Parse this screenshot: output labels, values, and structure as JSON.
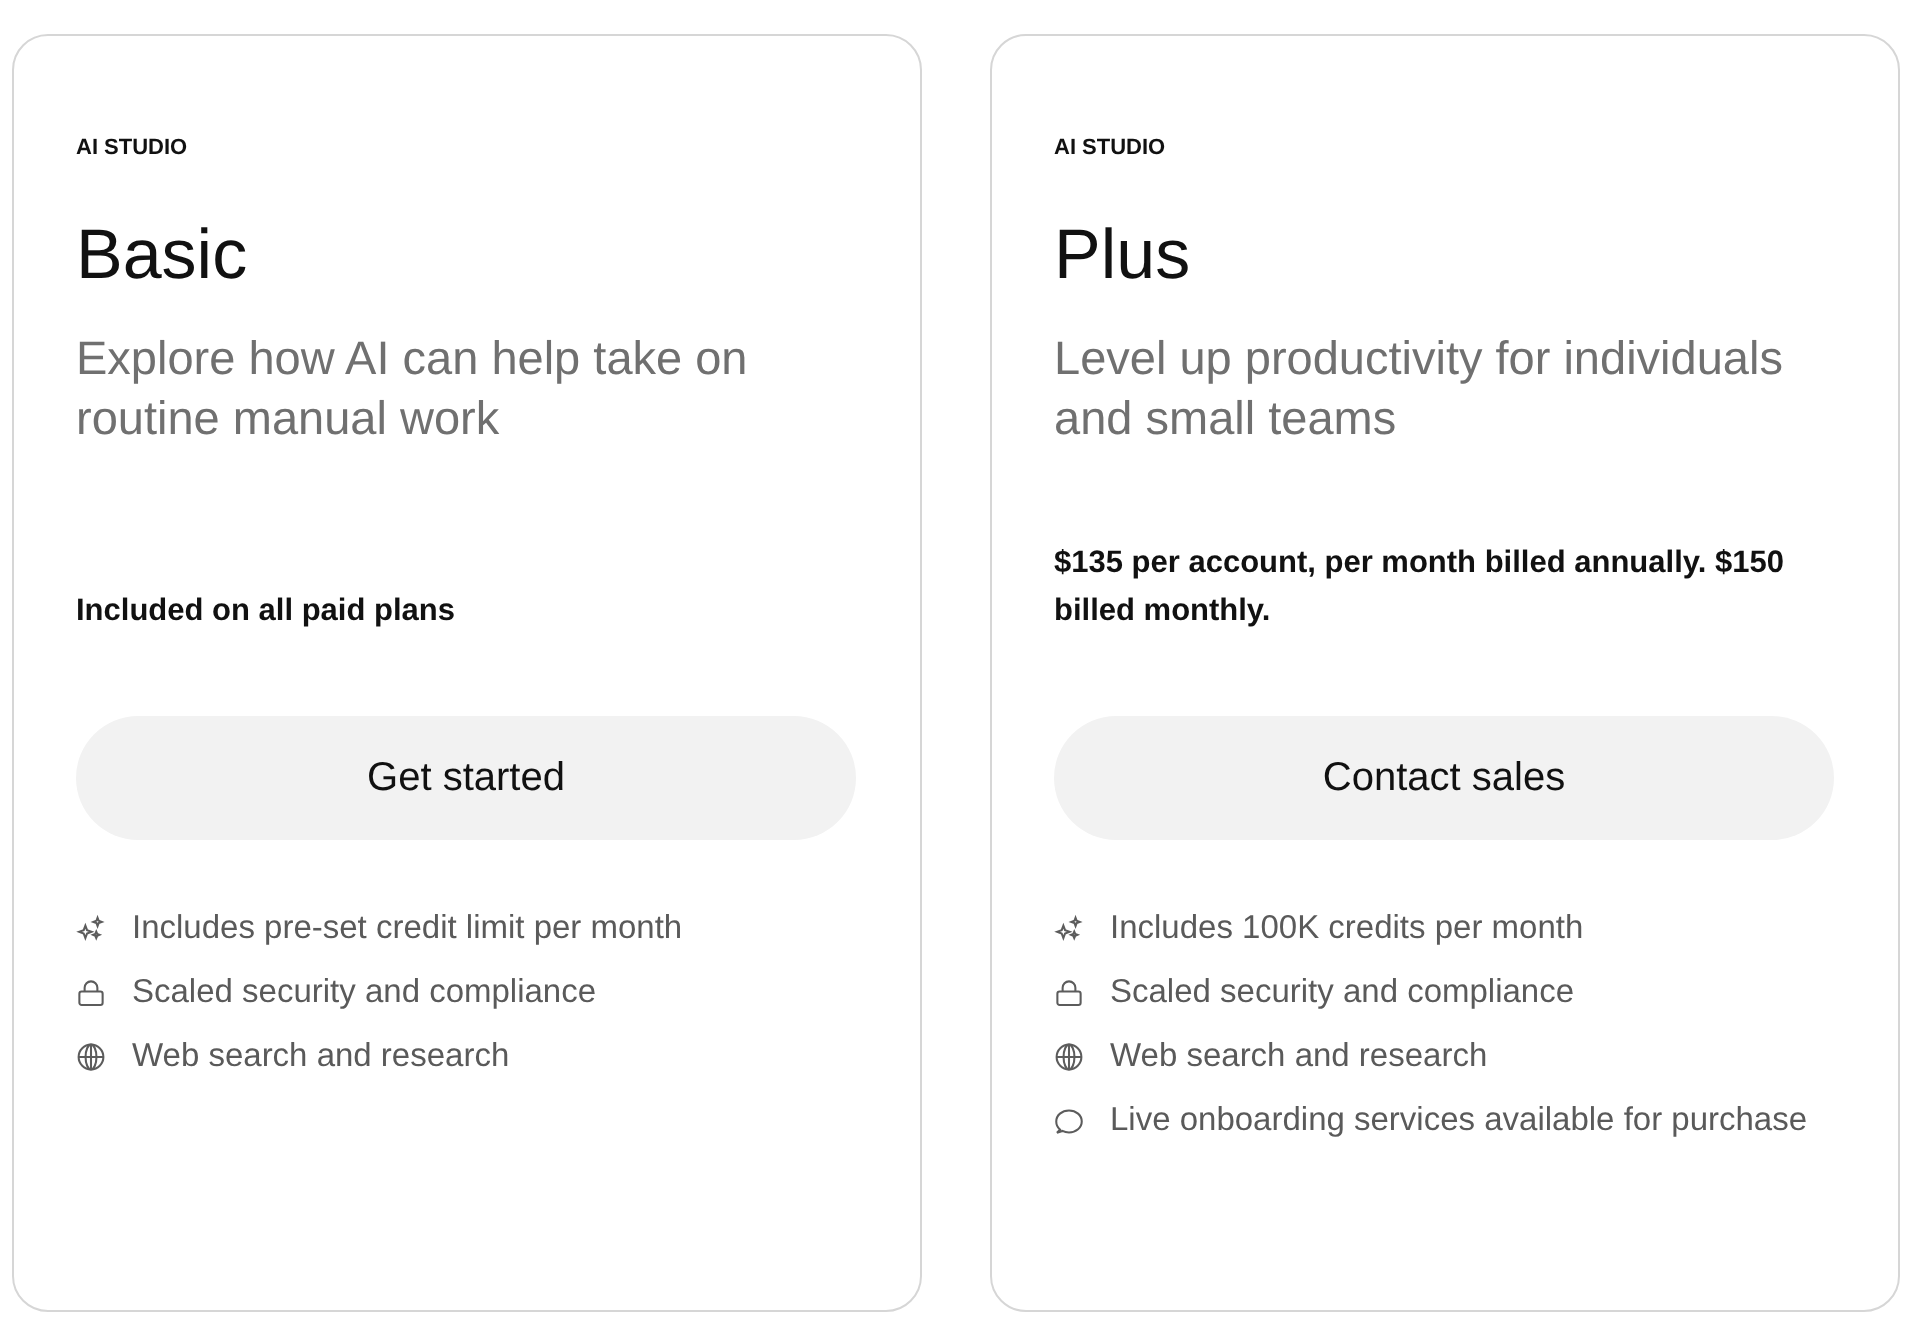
{
  "plans": [
    {
      "eyebrow": "AI STUDIO",
      "name": "Basic",
      "tagline": "Explore how AI can help take on routine manual work",
      "price_note": "Included on all paid plans",
      "button": "Get started",
      "features": [
        {
          "kind": "credits",
          "text": "Includes pre-set credit limit per month"
        },
        {
          "kind": "security",
          "text": "Scaled security and compliance"
        },
        {
          "kind": "web",
          "text": "Web search and research"
        }
      ]
    },
    {
      "eyebrow": "AI STUDIO",
      "name": "Plus",
      "tagline": "Level up productivity for individuals and small teams",
      "price_note": "$135 per account, per month billed annually. $150 billed monthly.",
      "button": "Contact sales",
      "features": [
        {
          "kind": "credits",
          "text": "Includes 100K credits per month"
        },
        {
          "kind": "security",
          "text": "Scaled security and compliance"
        },
        {
          "kind": "web",
          "text": "Web search and research"
        },
        {
          "kind": "onboarding",
          "text": "Live onboarding services available for purchase"
        }
      ]
    }
  ]
}
